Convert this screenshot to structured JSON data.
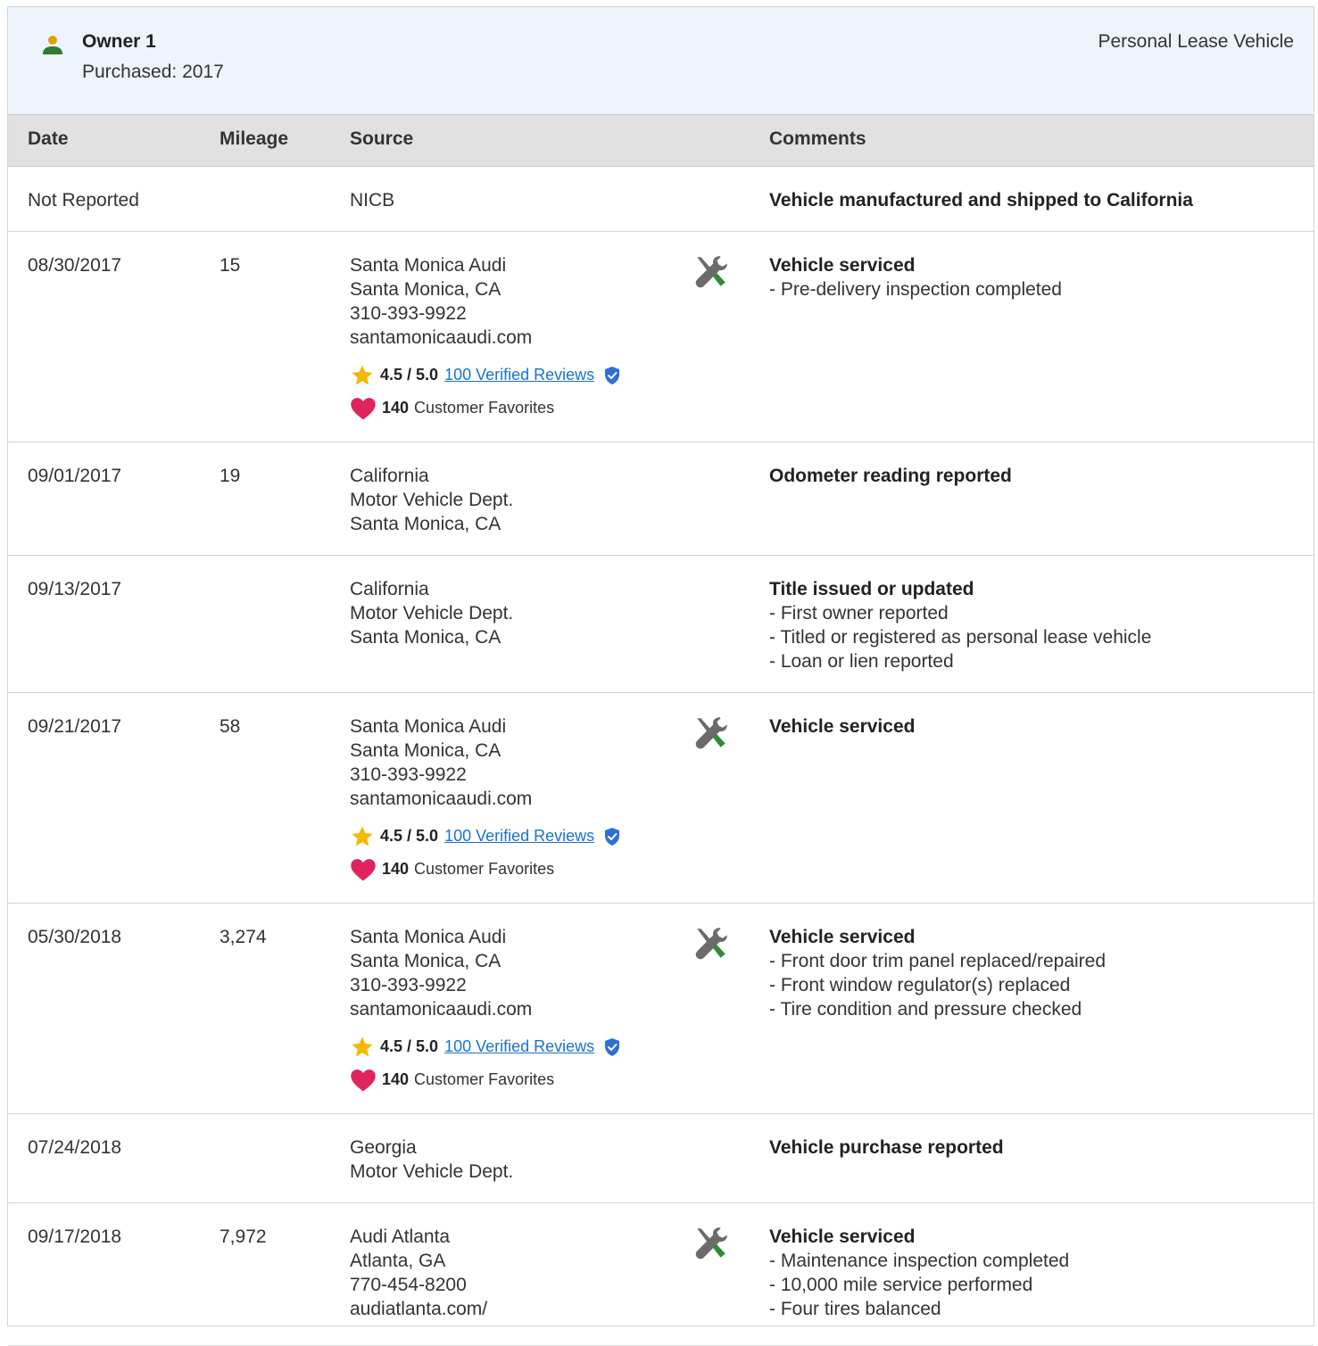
{
  "owner": {
    "title": "Owner 1",
    "purchased": "Purchased: 2017",
    "type": "Personal Lease Vehicle"
  },
  "table": {
    "headers": {
      "date": "Date",
      "mileage": "Mileage",
      "source": "Source",
      "comments": "Comments"
    }
  },
  "rows": [
    {
      "date": "Not Reported",
      "mileage": "",
      "source": [
        "NICB"
      ],
      "comment_head": "Vehicle manufactured and shipped to California",
      "comment_items": []
    },
    {
      "date": "08/30/2017",
      "mileage": "15",
      "source": [
        "Santa Monica Audi",
        "Santa Monica, CA",
        "310-393-9922",
        "santamonicaaudi.com"
      ],
      "service_icon": "wrench-screwdriver-icon",
      "rating": {
        "value": "4.5 / 5.0",
        "reviews": "100 Verified Reviews",
        "favorites_count": "140",
        "favorites_label": "Customer Favorites"
      },
      "comment_head": "Vehicle serviced",
      "comment_items": [
        "- Pre-delivery inspection completed"
      ]
    },
    {
      "date": "09/01/2017",
      "mileage": "19",
      "source": [
        "California",
        "Motor Vehicle Dept.",
        "Santa Monica, CA"
      ],
      "comment_head": "Odometer reading reported",
      "comment_items": []
    },
    {
      "date": "09/13/2017",
      "mileage": "",
      "source": [
        "California",
        "Motor Vehicle Dept.",
        "Santa Monica, CA"
      ],
      "comment_head": "Title issued or updated",
      "comment_items": [
        "- First owner reported",
        "- Titled or registered as personal lease vehicle",
        "- Loan or lien reported"
      ]
    },
    {
      "date": "09/21/2017",
      "mileage": "58",
      "source": [
        "Santa Monica Audi",
        "Santa Monica, CA",
        "310-393-9922",
        "santamonicaaudi.com"
      ],
      "service_icon": "wrench-screwdriver-icon",
      "rating": {
        "value": "4.5 / 5.0",
        "reviews": "100 Verified Reviews",
        "favorites_count": "140",
        "favorites_label": "Customer Favorites"
      },
      "comment_head": "Vehicle serviced",
      "comment_items": []
    },
    {
      "date": "05/30/2018",
      "mileage": "3,274",
      "source": [
        "Santa Monica Audi",
        "Santa Monica, CA",
        "310-393-9922",
        "santamonicaaudi.com"
      ],
      "service_icon": "wrench-screwdriver-icon",
      "rating": {
        "value": "4.5 / 5.0",
        "reviews": "100 Verified Reviews",
        "favorites_count": "140",
        "favorites_label": "Customer Favorites"
      },
      "comment_head": "Vehicle serviced",
      "comment_items": [
        "- Front door trim panel replaced/repaired",
        "- Front window regulator(s) replaced",
        "- Tire condition and pressure checked"
      ]
    },
    {
      "date": "07/24/2018",
      "mileage": "",
      "source": [
        "Georgia",
        "Motor Vehicle Dept."
      ],
      "comment_head": "Vehicle purchase reported",
      "comment_items": []
    },
    {
      "date": "09/17/2018",
      "mileage": "7,972",
      "source": [
        "Audi Atlanta",
        "Atlanta, GA",
        "770-454-8200",
        "audiatlanta.com/"
      ],
      "service_icon": "wrench-screwdriver-icon",
      "comment_head": "Vehicle serviced",
      "comment_items": [
        "- Maintenance inspection completed",
        "- 10,000 mile service performed",
        "- Four tires balanced"
      ]
    }
  ],
  "colors": {
    "header_bg": "#eef4fb",
    "table_head_bg": "#e1e1e1",
    "link": "#1a73c9",
    "star": "#f5b800",
    "heart": "#e0245e",
    "verified": "#2f6fd6",
    "owner_icon_head": "#d9a400",
    "owner_icon_body": "#2e7d32",
    "service_icon_green": "#2e8b3a",
    "service_icon_gray": "#6b6b6b"
  }
}
